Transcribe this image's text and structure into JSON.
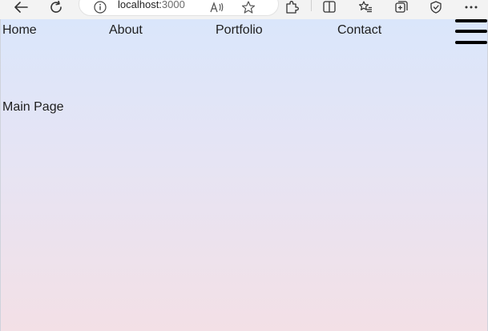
{
  "browser": {
    "url_host": "localhost:",
    "url_port": "3000",
    "icons": [
      "back-icon",
      "refresh-icon",
      "info-icon",
      "read-aloud-icon",
      "favorite-star-icon",
      "extensions-icon",
      "split-screen-icon",
      "favorites-icon",
      "collections-icon",
      "browser-essentials-icon",
      "more-options-icon"
    ]
  },
  "nav": {
    "items": [
      {
        "label": "Home"
      },
      {
        "label": "About"
      },
      {
        "label": "Portfolio"
      },
      {
        "label": "Contact"
      }
    ],
    "menu_icon": "hamburger-menu-icon"
  },
  "main": {
    "title": "Main Page"
  },
  "colors": {
    "gradient_top": "#dae6fb",
    "gradient_bottom": "#f3e0e6",
    "text": "#1e1e1e",
    "menu_icon": "#000000"
  }
}
